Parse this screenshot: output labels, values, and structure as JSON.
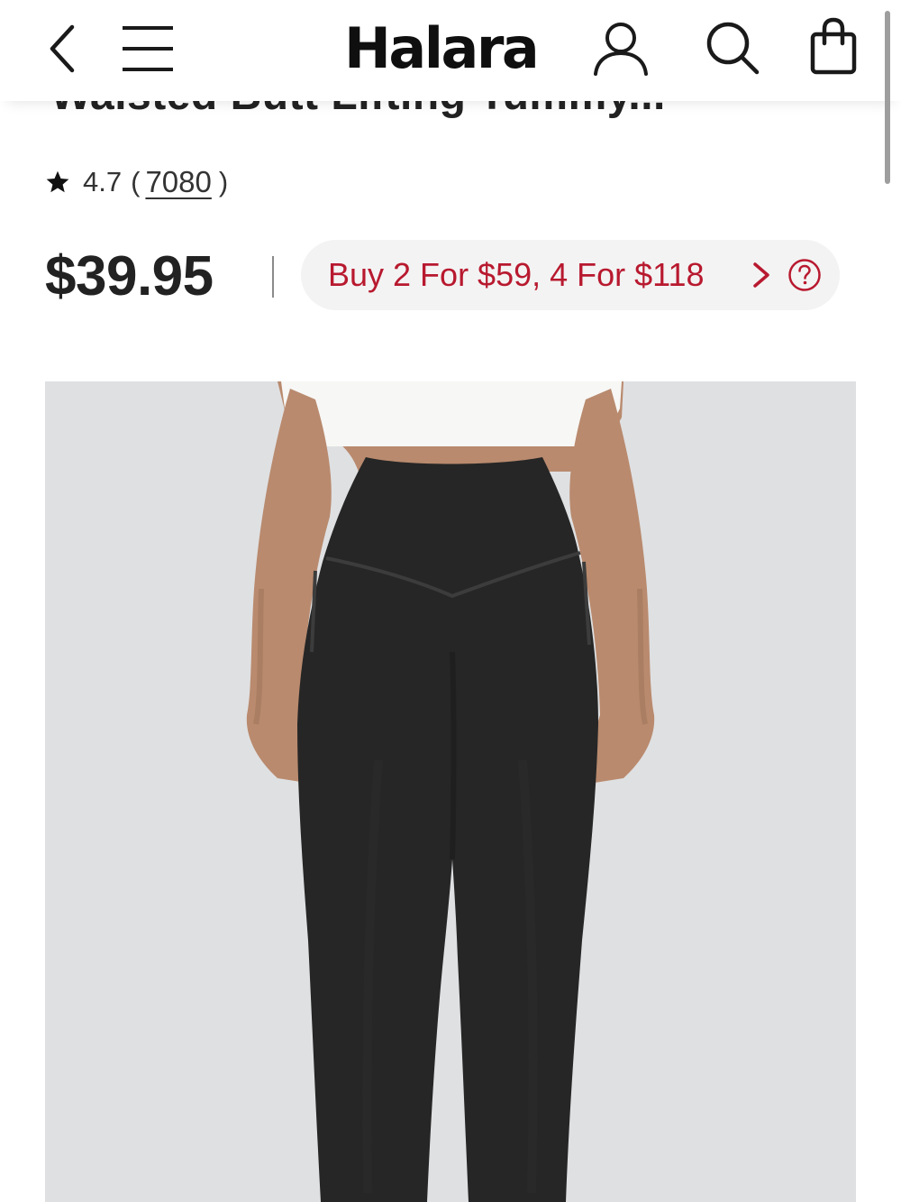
{
  "header": {
    "logo_text": "Halara",
    "icons": {
      "back": "chevron-left-icon",
      "menu": "hamburger-menu-icon",
      "account": "user-icon",
      "search": "search-icon",
      "bag": "shopping-bag-icon"
    }
  },
  "product": {
    "title_partial": "Waisted Butt Lifting Tummy...",
    "rating": {
      "value": "4.7",
      "open_paren": "(",
      "review_count": "7080",
      "close_paren": ")"
    },
    "price": "$39.95",
    "promo": {
      "text": "Buy 2 For $59, 4 For $118",
      "arrow_icon": "chevron-right-icon",
      "help_icon": "question-circle-icon"
    }
  },
  "colors": {
    "promo_text": "#b8192f",
    "promo_background": "#f3f3f3",
    "image_background": "#dfe0e2",
    "leggings": "#262626",
    "top": "#f7f7f5"
  }
}
